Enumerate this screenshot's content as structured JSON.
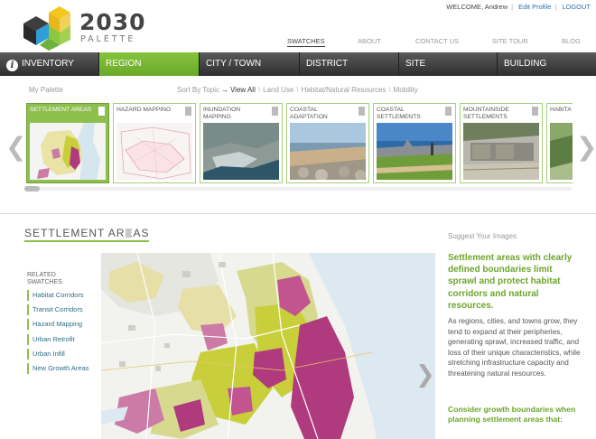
{
  "brand": {
    "year": "2030",
    "name": "PALETTE"
  },
  "userbar": {
    "welcome": "WELCOME, Andrew",
    "edit_profile": "Edit Profile",
    "logout": "LOGOUT"
  },
  "topnav": [
    "SWATCHES",
    "ABOUT",
    "CONTACT US",
    "SITE TOUR",
    "BLOG"
  ],
  "mainnav": {
    "info_glyph": "i",
    "items": [
      "INVENTORY",
      "REGION",
      "CITY / TOWN",
      "DISTRICT",
      "SITE",
      "BUILDING"
    ],
    "active": "REGION"
  },
  "filters": {
    "my_palette": "My Palette",
    "sort_by": "Sort By Topic",
    "view_all": "View All",
    "topics": [
      "Land Use",
      "Habitat/Natural Resources",
      "Mobility"
    ]
  },
  "carousel": {
    "left_glyph": "❮",
    "right_glyph": "❯",
    "swatches": [
      {
        "label": "SETTLEMENT AREAS",
        "selected": true
      },
      {
        "label": "HAZARD MAPPING",
        "selected": false
      },
      {
        "label": "INUNDATION MAPPING",
        "selected": false
      },
      {
        "label": "COASTAL ADAPTATION",
        "selected": false
      },
      {
        "label": "COASTAL SETTLEMENTS",
        "selected": false
      },
      {
        "label": "MOUNTAINSIDE SETTLEMENTS",
        "selected": false
      },
      {
        "label": "HABITA",
        "selected": false
      }
    ]
  },
  "detail": {
    "title": "SETTLEMENT AREAS",
    "related_heading": "RELATED SWATCHES",
    "related": [
      "Habitat Corridors",
      "Transit Corridors",
      "Hazard Mapping",
      "Urban Retrofit",
      "Urban Infill",
      "New Growth Areas"
    ],
    "next_glyph": "❯",
    "suggest": "Suggest Your Images",
    "lead": "Settlement areas with clearly defined boundaries limit sprawl and protect habitat corridors and natural resources.",
    "body": "As regions, cities, and towns grow, they tend to expand at their peripheries, generating sprawl, increased traffic, and loss of their unique characteristics, while stretching infrastructure capacity and threatening natural resources.",
    "consider": "Consider growth boundaries when planning settlement areas that:"
  },
  "colors": {
    "accent_green": "#8dbf4e",
    "heading_green": "#6da52b",
    "link_blue": "#2a6fb8",
    "map_magenta": "#b03a7e",
    "map_yellow": "#c8cf3a",
    "water_blue": "#d6e6ef"
  }
}
